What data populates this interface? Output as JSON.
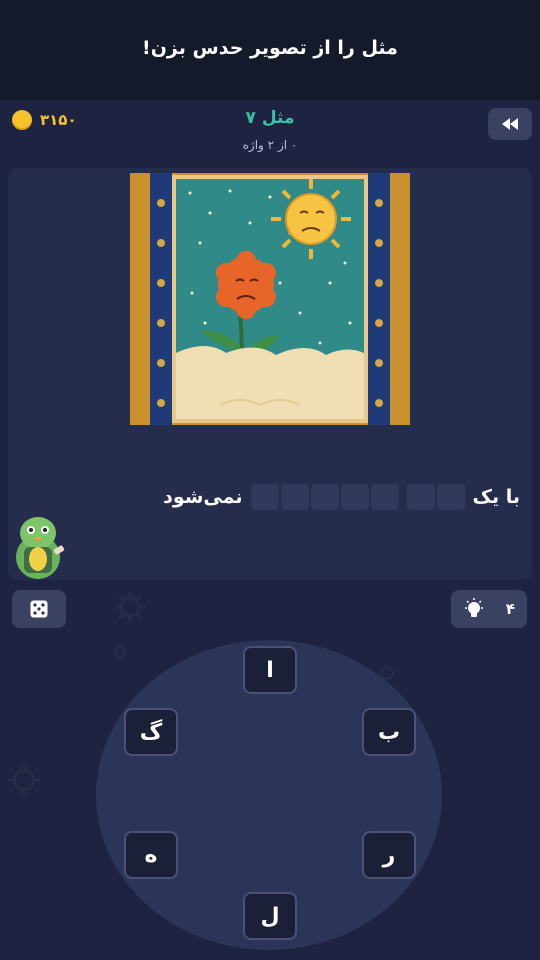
{
  "header": {
    "title": "مثل را از تصویر حدس بزن!"
  },
  "status": {
    "coins": "۳۱۵۰",
    "level_title": "مثل ۷",
    "progress": "۰ از ۲ واژه"
  },
  "riddle": {
    "prefix": "با یک",
    "suffix": "نمی‌شود",
    "blank_groups": [
      2,
      5
    ]
  },
  "hint": {
    "count": "۴"
  },
  "wheel": {
    "letters": [
      "ا",
      "ب",
      "ر",
      "ل",
      "ه",
      "گ"
    ]
  },
  "colors": {
    "accent": "#39c0a6",
    "coin": "#f6c22b",
    "background": "#1d2340",
    "card": "#252c4c",
    "button": "#3a4161"
  },
  "icons": {
    "back": "rewind-icon",
    "coin": "coin-icon",
    "dice": "dice-icon",
    "hint": "lightbulb-icon"
  }
}
